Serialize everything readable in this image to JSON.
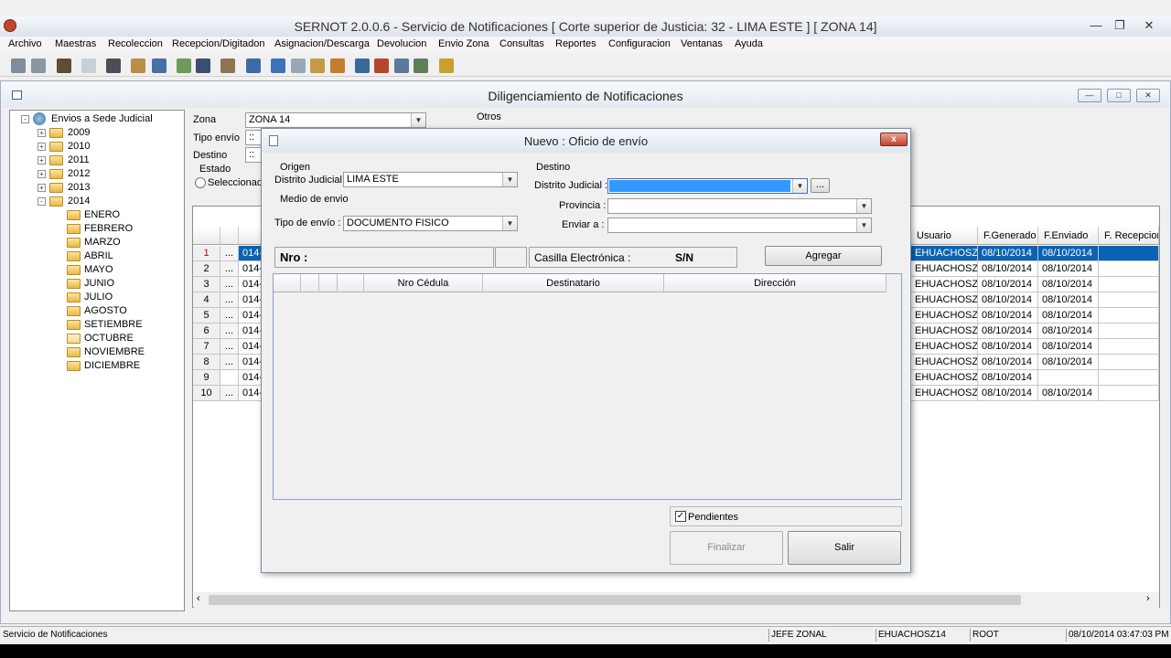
{
  "app": {
    "title": "SERNOT  2.0.0.6 - Servicio de Notificaciones [ Corte superior de Justicia: 32  -  LIMA ESTE ]   [ ZONA 14]"
  },
  "menu": [
    "Archivo",
    "Maestras",
    "Recoleccion",
    "Recepcion/Digitadon",
    "Asignacion/Descarga",
    "Devolucion",
    "Envio Zona",
    "Consultas",
    "Reportes",
    "Configuracion",
    "Ventanas",
    "Ayuda"
  ],
  "child": {
    "title": "Diligenciamiento de Notificaciones"
  },
  "tree": {
    "root": "Envios a Sede Judicial",
    "years": [
      "2009",
      "2010",
      "2011",
      "2012",
      "2013",
      "2014"
    ],
    "months": [
      "ENERO",
      "FEBRERO",
      "MARZO",
      "ABRIL",
      "MAYO",
      "JUNIO",
      "JULIO",
      "AGOSTO",
      "SETIEMBRE",
      "OCTUBRE",
      "NOVIEMBRE",
      "DICIEMBRE"
    ]
  },
  "filters": {
    "zona_label": "Zona",
    "zona_value": "ZONA 14",
    "otros_label": "Otros",
    "tipo_envio_label": "Tipo envío",
    "tipo_envio_value": "::",
    "destino_label": "Destino",
    "destino_value": "::",
    "estado_label": "Estado",
    "seleccionado_label": "Seleccionado"
  },
  "grid": {
    "headers": {
      "usuario": "Usuario",
      "generado": "F.Generado",
      "enviado": "F.Enviado",
      "recepcion": "F. Recepcior"
    },
    "rows": [
      {
        "n": "1",
        "btn": "...",
        "code": "014-",
        "usuario": "EHUACHOSZ14",
        "generado": "08/10/2014",
        "enviado": "08/10/2014"
      },
      {
        "n": "2",
        "btn": "...",
        "code": "014-",
        "usuario": "EHUACHOSZ14",
        "generado": "08/10/2014",
        "enviado": "08/10/2014"
      },
      {
        "n": "3",
        "btn": "...",
        "code": "014-",
        "usuario": "EHUACHOSZ14",
        "generado": "08/10/2014",
        "enviado": "08/10/2014"
      },
      {
        "n": "4",
        "btn": "...",
        "code": "014-",
        "usuario": "EHUACHOSZ14",
        "generado": "08/10/2014",
        "enviado": "08/10/2014"
      },
      {
        "n": "5",
        "btn": "...",
        "code": "014-",
        "usuario": "EHUACHOSZ14",
        "generado": "08/10/2014",
        "enviado": "08/10/2014"
      },
      {
        "n": "6",
        "btn": "...",
        "code": "014-",
        "usuario": "EHUACHOSZ14",
        "generado": "08/10/2014",
        "enviado": "08/10/2014"
      },
      {
        "n": "7",
        "btn": "...",
        "code": "014-",
        "usuario": "EHUACHOSZ14",
        "generado": "08/10/2014",
        "enviado": "08/10/2014"
      },
      {
        "n": "8",
        "btn": "...",
        "code": "014-",
        "usuario": "EHUACHOSZ14",
        "generado": "08/10/2014",
        "enviado": "08/10/2014"
      },
      {
        "n": "9",
        "btn": "",
        "code": "014-",
        "usuario": "EHUACHOSZ14",
        "generado": "08/10/2014",
        "enviado": ""
      },
      {
        "n": "10",
        "btn": "...",
        "code": "014-",
        "usuario": "EHUACHOSZ14",
        "generado": "08/10/2014",
        "enviado": "08/10/2014"
      }
    ]
  },
  "dialog": {
    "title": "Nuevo : Oficio de envío",
    "close": "x",
    "origen": "Origen",
    "destino": "Destino",
    "distrito_label": "Distrito Judicial :",
    "distrito_value": "LIMA ESTE",
    "destino_distrito_label": "Distrito Judicial :",
    "provincia_label": "Provincia :",
    "enviar_label": "Enviar a :",
    "medio_label": "Medio de envio",
    "tipo_label": "Tipo de envío :",
    "tipo_value": "DOCUMENTO FISICO",
    "nro_label": "Nro :",
    "casilla_label": "Casilla Electrónica :",
    "casilla_value": "S/N",
    "agregar": "Agregar",
    "browse": "...",
    "cols": {
      "cedula": "Nro Cédula",
      "destinatario": "Destinatario",
      "direccion": "Dirección"
    },
    "pendientes": "Pendientes",
    "finalizar": "Finalizar",
    "salir": "Salir"
  },
  "status": {
    "app": "Servicio de Notificaciones",
    "role": "JEFE ZONAL",
    "user": "EHUACHOSZ14",
    "db": "ROOT",
    "datetime": "08/10/2014 03:47:03 PM"
  },
  "colors": {
    "selection": "#3399ff",
    "grid_selected": "#0a63b3"
  }
}
